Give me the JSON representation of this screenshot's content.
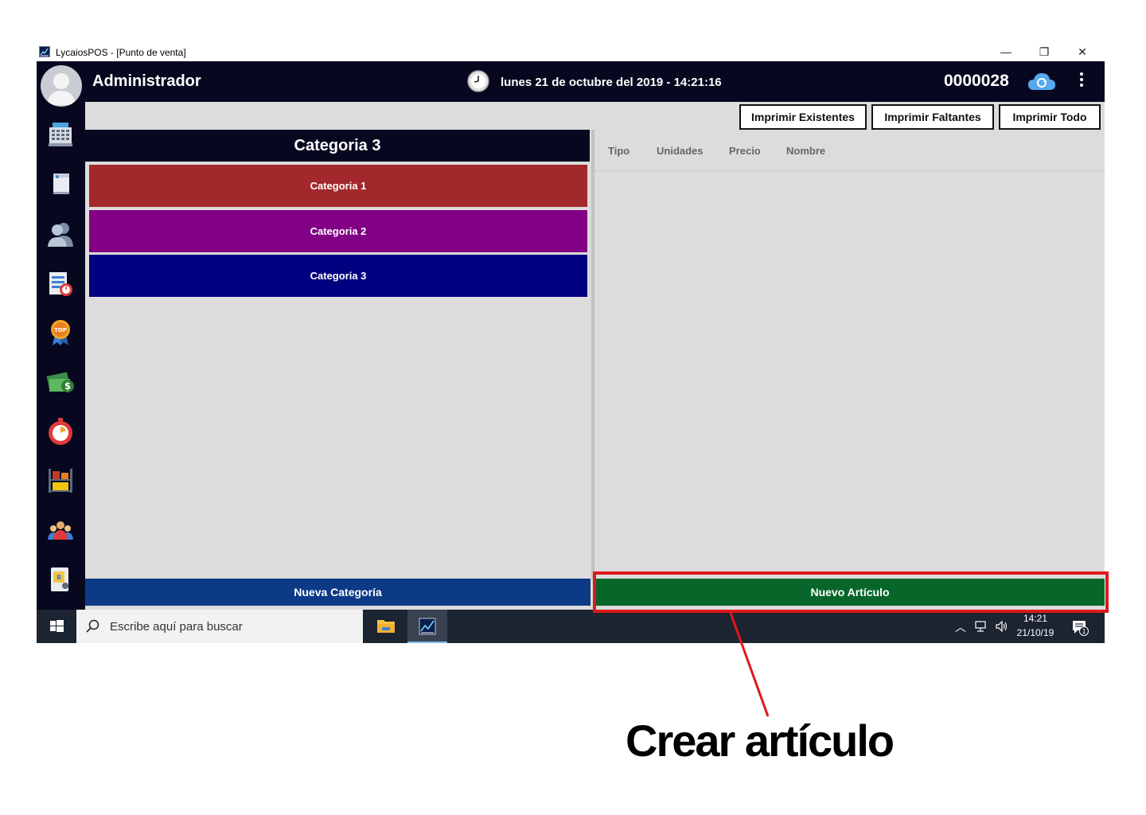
{
  "window": {
    "title": "LycaiosPOS - [Punto de venta]",
    "controls": {
      "minimize": "—",
      "maximize": "❐",
      "close": "✕"
    }
  },
  "header": {
    "user_name": "Administrador",
    "datetime": "lunes 21 de octubre del 2019 - 14:21:16",
    "ticket_number": "0000028",
    "icons": [
      "avatar",
      "clock-icon",
      "cloud-sync-icon",
      "more-vert-icon"
    ]
  },
  "sidebar": {
    "items": [
      {
        "name": "cash-register-icon"
      },
      {
        "name": "notepad-icon"
      },
      {
        "name": "users-icon"
      },
      {
        "name": "report-clock-icon"
      },
      {
        "name": "top-badge-icon"
      },
      {
        "name": "money-icon"
      },
      {
        "name": "stopwatch-icon"
      },
      {
        "name": "inventory-shelf-icon"
      },
      {
        "name": "employees-icon"
      },
      {
        "name": "document-tablet-icon"
      }
    ]
  },
  "toolbar": {
    "print_existing": "Imprimir Existentes",
    "print_missing": "Imprimir Faltantes",
    "print_all": "Imprimir Todo"
  },
  "categories": {
    "selected_title": "Categoria 3",
    "items": [
      {
        "label": "Categoria 1",
        "color": "#a3282c"
      },
      {
        "label": "Categoria 2",
        "color": "#810083"
      },
      {
        "label": "Categoria 3",
        "color": "#000080"
      }
    ],
    "new_button": "Nueva Categoría"
  },
  "articles": {
    "columns": [
      "Tipo",
      "Unidades",
      "Precio",
      "Nombre"
    ],
    "rows": [],
    "new_button": "Nuevo Artículo"
  },
  "taskbar": {
    "search_placeholder": "Escribe aquí para buscar",
    "time": "14:21",
    "date": "21/10/19",
    "notification_count": "1"
  },
  "annotation": {
    "label": "Crear artículo",
    "color": "#e0181b"
  }
}
